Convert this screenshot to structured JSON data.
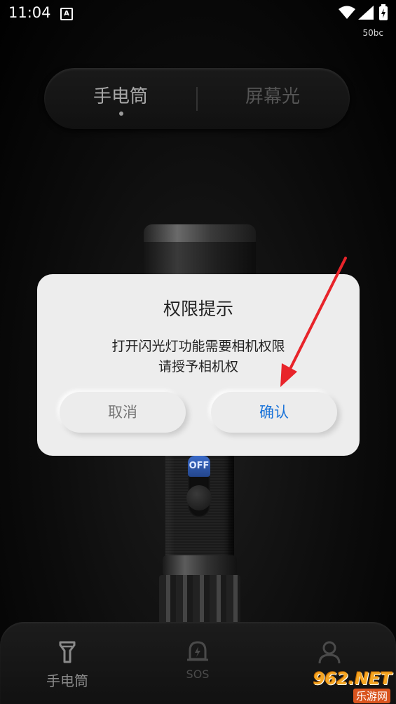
{
  "status_bar": {
    "time": "11:04",
    "notification_glyph": "A",
    "net_speed": "50bc"
  },
  "mode_switch": {
    "active_tab": "手电筒",
    "inactive_tab": "屏幕光"
  },
  "flashlight": {
    "switch_label": "OFF"
  },
  "dialog": {
    "title": "权限提示",
    "message_line1": "打开闪光灯功能需要相机权限",
    "message_line2": "请授予相机权",
    "cancel_label": "取消",
    "confirm_label": "确认"
  },
  "bottom_nav": {
    "items": [
      {
        "label": "手电筒",
        "icon": "flashlight-icon",
        "active": true
      },
      {
        "label": "SOS",
        "icon": "sos-icon",
        "active": false
      },
      {
        "label": "",
        "icon": "profile-icon",
        "active": false
      }
    ]
  },
  "watermark": {
    "main": "962.NET",
    "sub": "乐游网"
  },
  "colors": {
    "accent_blue": "#1a73d9",
    "arrow_red": "#e8242a"
  }
}
